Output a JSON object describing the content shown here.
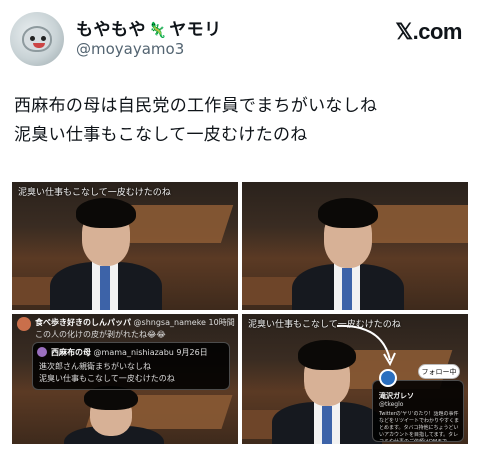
{
  "author": {
    "display_name_left": "もやもや",
    "display_name_icon": "gecko-icon",
    "display_name_right": "ヤモリ",
    "handle": "@moyayamo3"
  },
  "brand": {
    "logo_text": "𝕏.com"
  },
  "tweet": {
    "line1": "西麻布の母は自民党の工作員でまちがいなしね",
    "line2": "泥臭い仕事もこなして一皮むけたのね"
  },
  "images": {
    "caption": "泥臭い仕事もこなして一皮むけたのね",
    "quote": {
      "name": "食べ歩き好きのしんパッパ",
      "handle": "@shngsa_nameke",
      "time": "10時間",
      "text": "この人の化けの皮が剥がれたね😂😂",
      "inner_name": "西麻布の母",
      "inner_handle": "@mama_nishiazabu",
      "inner_time": "9月26日",
      "inner_line1": "進次郎さん親衛まちがいなしね",
      "inner_line2": "泥臭い仕事もこなして一皮むけたのね"
    },
    "profile": {
      "follow_label": "フォロー中",
      "name": "滝沢ガレソ",
      "handle": "@tkeglo",
      "bio": "Twitterの'ヤリ'のたり！話題の事件などをリツイートでわかりやすくまとめます。タバコ持他にちょうどいいアカウントを目指してます。タレコミや仕事のご依頼はDMまで"
    }
  }
}
